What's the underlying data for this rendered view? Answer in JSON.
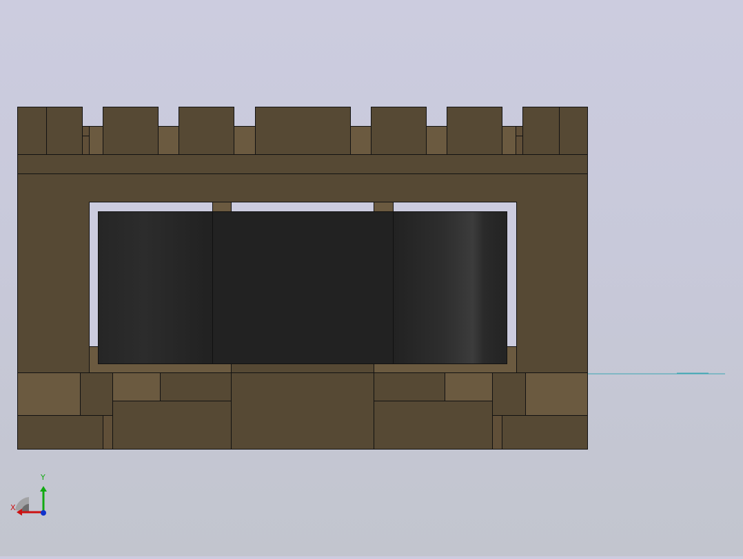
{
  "viewport": {
    "colors": {
      "background_top": "#ccccdf",
      "background_bottom": "#c2c5ce",
      "part_face": "#564934",
      "part_face_light": "#6b5a40",
      "part_face_mid": "#604f38",
      "rubber_roller": "#222222",
      "edge_line": "#000000",
      "sketch_line": "#3aa6b2"
    }
  },
  "triad": {
    "x_label": "X",
    "y_label": "Y",
    "x_color": "#cc1111",
    "y_color": "#11aa11",
    "z_color": "#1133cc"
  }
}
